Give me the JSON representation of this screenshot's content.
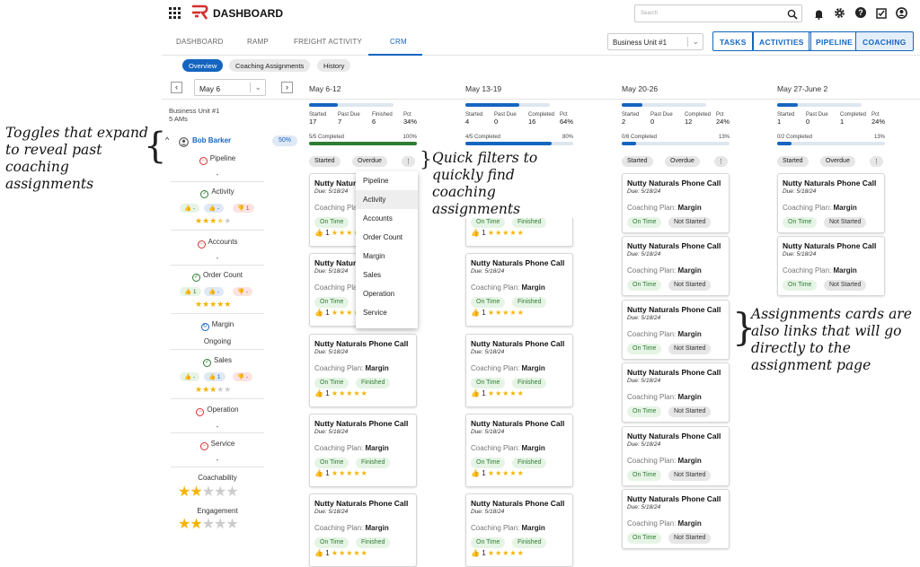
{
  "annotations": {
    "left": [
      "Toggles that expand",
      "to reveal past",
      "coaching assignments"
    ],
    "middle": [
      "Quick filters to",
      "quickly find coaching",
      "assignments"
    ],
    "right": [
      "Assignments cards are",
      "also links that will go",
      "directly to the",
      "assignment page"
    ]
  },
  "app": {
    "title": "DASHBOARD",
    "search_placeholder": "Search"
  },
  "tabs": [
    "DASHBOARD",
    "RAMP",
    "FREIGHT ACTIVITY",
    "CRM"
  ],
  "active_tab": "CRM",
  "business_unit": "Business Unit #1",
  "buttons": [
    "TASKS",
    "ACTIVITIES",
    "PIPELINE",
    "COACHING"
  ],
  "subtabs": [
    "Overview",
    "Coaching Assignments",
    "History"
  ],
  "date_select": "May 6",
  "summary": {
    "unit": "Business Unit #1",
    "ams": "5 AMs"
  },
  "columns": [
    {
      "head": "May 6-12",
      "started": "17",
      "past_due": "7",
      "finished": "6",
      "pct": "34%",
      "fill": 0.34,
      "completed": "5/5 Completed",
      "comp_pct": "100%",
      "cfill": 1.0,
      "finishlabel": "Finished"
    },
    {
      "head": "May 13-19",
      "started": "4",
      "past_due": "0",
      "finished": "16",
      "pct": "64%",
      "fill": 0.64,
      "completed": "4/5 Completed",
      "comp_pct": "80%",
      "cfill": 0.8,
      "finishlabel": "Completed"
    },
    {
      "head": "May 20-26",
      "started": "2",
      "past_due": "0",
      "finished": "12",
      "pct": "24%",
      "fill": 0.24,
      "completed": "0/8 Completed",
      "comp_pct": "13%",
      "cfill": 0.13,
      "finishlabel": "Completed"
    },
    {
      "head": "May 27-June 2",
      "started": "1",
      "past_due": "0",
      "finished": "1",
      "pct": "24%",
      "fill": 0.24,
      "completed": "0/2 Completed",
      "comp_pct": "13%",
      "cfill": 0.13,
      "finishlabel": "Completed"
    }
  ],
  "stat_labels": {
    "started": "Started",
    "past_due": "Past Due",
    "pct": "Pct"
  },
  "filters": {
    "started": "Started",
    "overdue": "Overdue",
    "more": "⋮"
  },
  "person": {
    "name": "Bob Barker",
    "pct": "50%"
  },
  "side": {
    "pipeline": "Pipeline",
    "pipeline_val": "-",
    "activity": "Activity",
    "accounts": "Accounts",
    "accounts_val": "-",
    "order_count": "Order Count",
    "margin": "Margin",
    "margin_val": "Ongoing",
    "sales": "Sales",
    "operation": "Operation",
    "operation_val": "-",
    "service": "Service",
    "service_val": "-",
    "coachability": "Coachability",
    "engagement": "Engagement"
  },
  "thumb_vals": {
    "up": "-",
    "mid": "-",
    "down": "1",
    "up1": "1",
    "mid1": "-",
    "down1": "-",
    "up2": "-",
    "mid2": "1",
    "down2": "-"
  },
  "card": {
    "title": "Nutty Naturals Phone Call",
    "due": "Due: 5/18/24",
    "plan_label": "Coaching Plan:",
    "plan": "Margin",
    "on_time": "On Time",
    "finished": "Finished",
    "not_started": "Not Started",
    "rating": "1"
  },
  "dropdown": [
    "Pipeline",
    "Activity",
    "Accounts",
    "Order Count",
    "Margin",
    "Sales",
    "Operation",
    "Service"
  ],
  "colors": {
    "accent": "#1565c0",
    "green": "#2e7d32",
    "red": "#d32f2f",
    "star": "#f5b400",
    "logo": "#d32f2f"
  }
}
